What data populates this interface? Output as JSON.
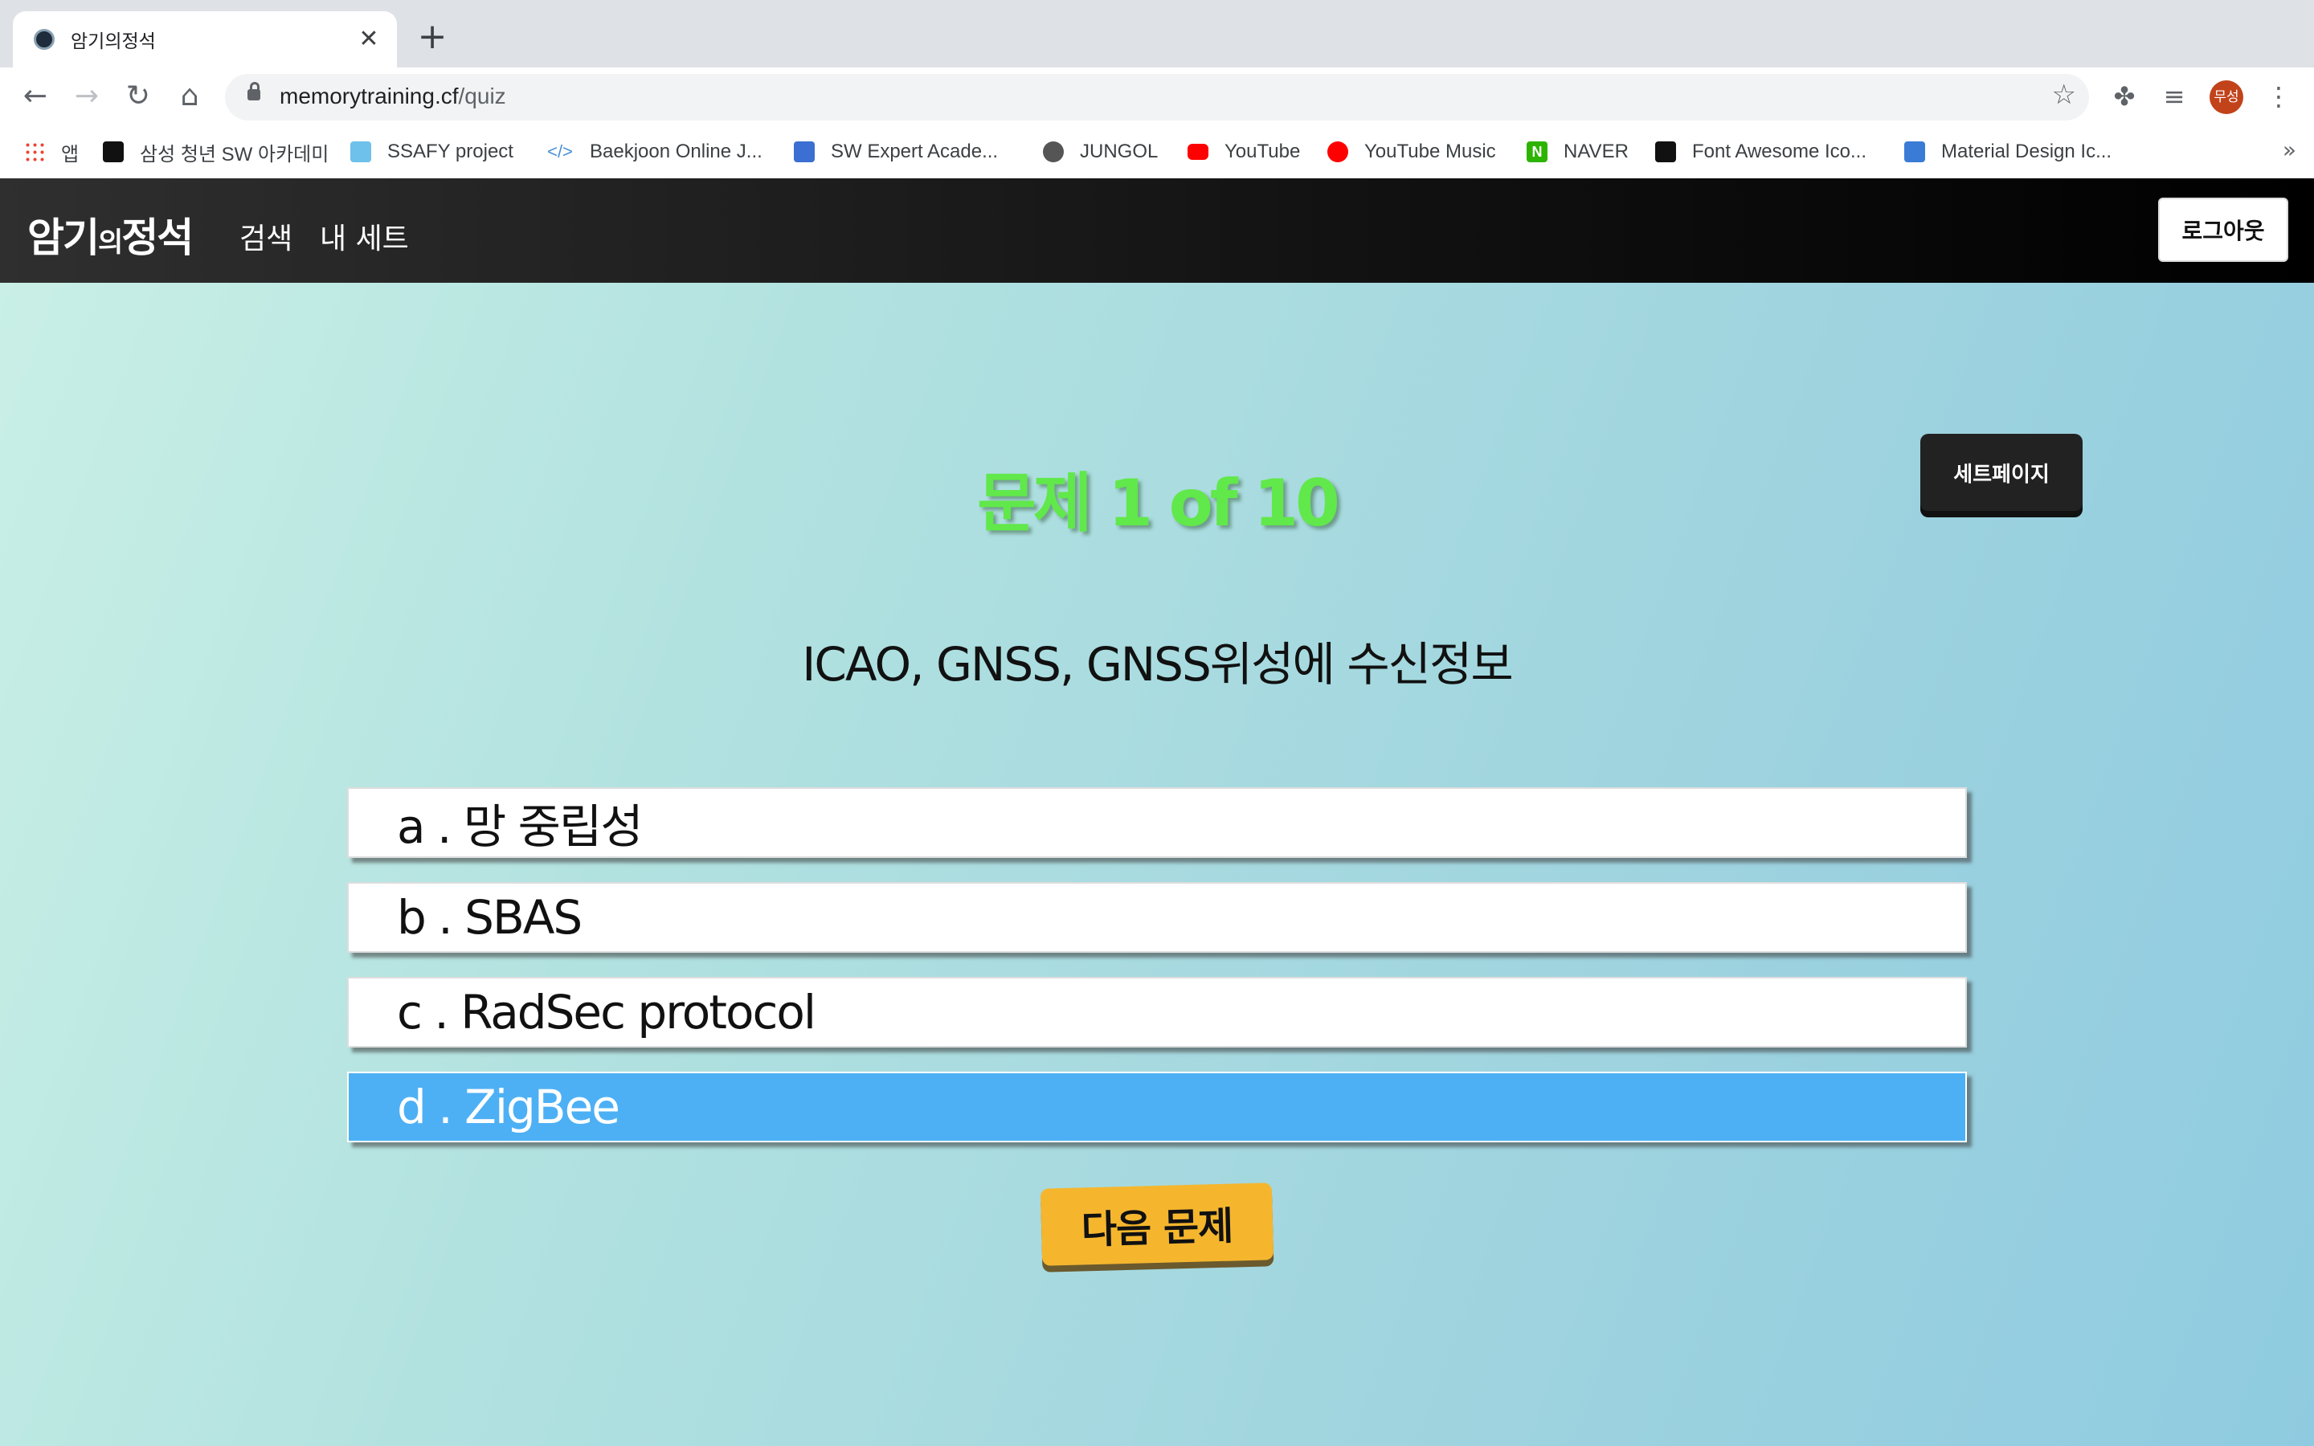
{
  "browser": {
    "tab_title": "암기의정석",
    "url_host": "memorytraining.cf",
    "url_path": "/quiz",
    "profile_label": "무성",
    "bookmarks": [
      {
        "label": "앱",
        "icon": "apps-grid-icon",
        "color": "#ea4335"
      },
      {
        "label": "삼성 청년 SW 아카데미",
        "icon": "ssafy-dark-icon",
        "color": "#111111"
      },
      {
        "label": "SSAFY project",
        "icon": "ssafy-light-icon",
        "color": "#6ec1ea"
      },
      {
        "label": "Baekjoon Online J...",
        "icon": "code-brackets-icon",
        "color": "#4a90d9"
      },
      {
        "label": "SW Expert Acade...",
        "icon": "swea-icon",
        "color": "#3b6fd1"
      },
      {
        "label": "JUNGOL",
        "icon": "globe-icon",
        "color": "#555555"
      },
      {
        "label": "YouTube",
        "icon": "youtube-icon",
        "color": "#ff0000"
      },
      {
        "label": "YouTube Music",
        "icon": "youtube-music-icon",
        "color": "#ff0000"
      },
      {
        "label": "NAVER",
        "icon": "naver-icon",
        "color": "#2db400"
      },
      {
        "label": "Font Awesome Ico...",
        "icon": "flag-icon",
        "color": "#111111"
      },
      {
        "label": "Material Design Ic...",
        "icon": "material-icon",
        "color": "#3a7bd5"
      }
    ]
  },
  "header": {
    "logo_main": "암기",
    "logo_small": "의",
    "logo_end": "정석",
    "nav": [
      "검색",
      "내 세트"
    ],
    "logout_label": "로그아웃"
  },
  "quiz": {
    "set_page_label": "세트페이지",
    "title": "문제 1 of 10",
    "question": "ICAO, GNSS, GNSS위성에 수신정보",
    "options": [
      {
        "label": "a . 망 중립성",
        "selected": false
      },
      {
        "label": "b . SBAS",
        "selected": false
      },
      {
        "label": "c . RadSec protocol",
        "selected": false
      },
      {
        "label": "d . ZigBee",
        "selected": true
      }
    ],
    "next_label": "다음 문제"
  },
  "colors": {
    "title_green": "#61e84a",
    "selected_blue": "#4db0f5",
    "next_yellow": "#f5b62e"
  }
}
